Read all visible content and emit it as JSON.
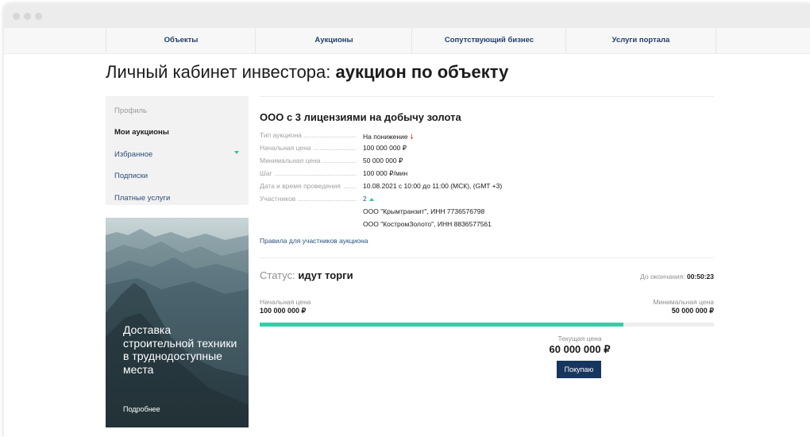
{
  "nav": {
    "items": [
      "Объекты",
      "Аукционы",
      "Сопутствующий бизнес",
      "Услуги портала"
    ]
  },
  "page": {
    "title_light": "Личный кабинет инвестора: ",
    "title_bold": "аукцион по объекту"
  },
  "sidebar": {
    "items": [
      {
        "label": "Профиль"
      },
      {
        "label": "Мои аукционы"
      },
      {
        "label": "Избранное"
      },
      {
        "label": "Подписки"
      },
      {
        "label": "Платные услуги"
      }
    ]
  },
  "promo": {
    "text": "Доставка строительной техники в труднодоступные места",
    "link": "Подробнее"
  },
  "lot": {
    "title": "ООО с 3 лицензиями на добычу золота",
    "rows": [
      {
        "label": "Тип аукциона",
        "value": "На понижение"
      },
      {
        "label": "Начальная цена",
        "value": "100 000 000 ₽"
      },
      {
        "label": "Минимальная цена",
        "value": "50 000 000 ₽"
      },
      {
        "label": "Шаг",
        "value": "100 000 ₽/мин"
      },
      {
        "label": "Дата и время проведения",
        "value": "10.08.2021 с 10:00 до 11:00 (МСК), (GMT +3)"
      },
      {
        "label": "Участников",
        "value": "2"
      }
    ],
    "participants": [
      "ООО \"Крымтранзит\", ИНН 7736576798",
      "ООО \"КостромЗолото\", ИНН 8836577561"
    ],
    "rules_link": "Правила для участников аукциона"
  },
  "auction": {
    "status_label": "Статус: ",
    "status_value": "идут торги",
    "countdown_label": "До окончания: ",
    "countdown_value": "00:50:23",
    "start_label": "Начальная цена",
    "start_value": "100 000 000 ₽",
    "min_label": "Минимальная цена",
    "min_value": "50 000 000 ₽",
    "current_label": "Текущая цена",
    "current_value": "60 000 000 ₽",
    "progress_fraction": 0.8,
    "buy_label": "Покупаю"
  },
  "colors": {
    "accent": "#2fd1a9",
    "navy": "#17365e",
    "down_arrow": "#e23b2e"
  }
}
